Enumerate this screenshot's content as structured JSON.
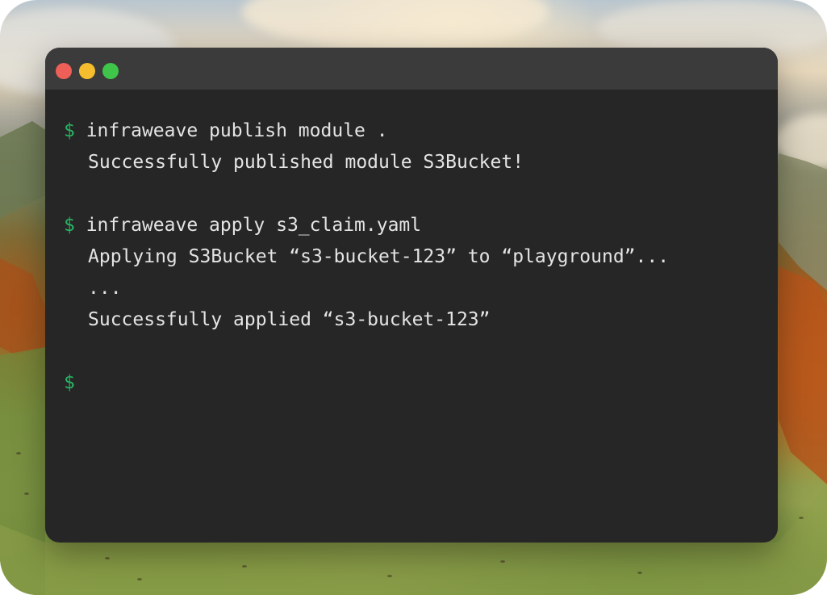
{
  "window": {
    "controls": [
      {
        "name": "close",
        "color": "#ee5f57"
      },
      {
        "name": "minimize",
        "color": "#f6bd2e"
      },
      {
        "name": "zoom",
        "color": "#3fc64a"
      }
    ],
    "background_color": "#262626",
    "titlebar_color": "#3b3b3b"
  },
  "terminal": {
    "prompt_symbol": "$",
    "prompt_color": "#28b463",
    "text_color": "#e4e4e4",
    "lines": [
      {
        "kind": "command",
        "text": "infraweave publish module ."
      },
      {
        "kind": "output",
        "text": "Successfully published module S3Bucket!"
      },
      {
        "kind": "command",
        "text": "infraweave apply s3_claim.yaml"
      },
      {
        "kind": "output",
        "text": "Applying S3Bucket “s3-bucket-123” to “playground”..."
      },
      {
        "kind": "output",
        "text": "..."
      },
      {
        "kind": "output",
        "text": "Successfully applied “s3-bucket-123”"
      },
      {
        "kind": "prompt",
        "text": ""
      }
    ]
  }
}
